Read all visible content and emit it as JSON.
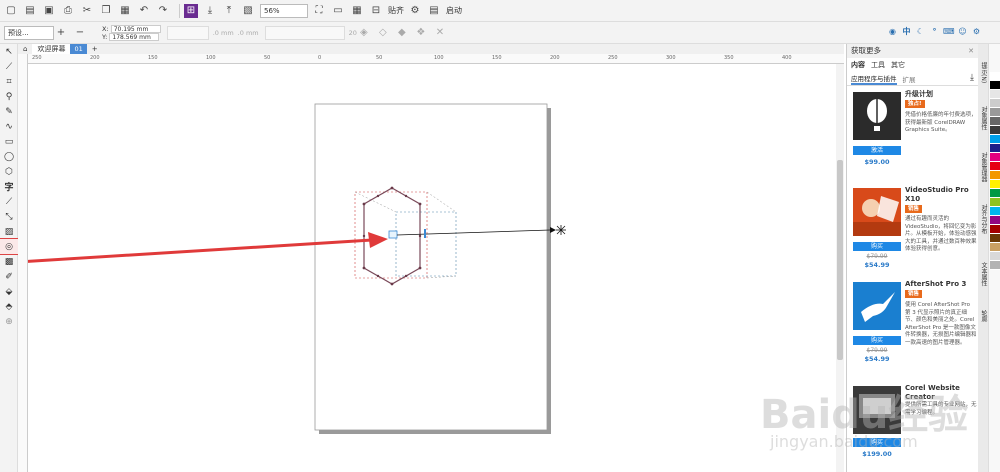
{
  "toolbar": {
    "zoom": "56%",
    "snap_label": "贴齐",
    "launch_label": "启动"
  },
  "propbar": {
    "preset": "预设...",
    "x": "70.195 mm",
    "y": "178.569 mm",
    "x_label": "X:",
    "y_label": "Y:",
    "mm1": ".0 mm",
    "mm2": ".0 mm",
    "steps": "20",
    "lang": "中"
  },
  "tabs": {
    "welcome": "欢迎屏幕",
    "doc": "01"
  },
  "ruler": {
    "h_ticks": [
      "250",
      "200",
      "150",
      "100",
      "50",
      "0",
      "50",
      "100",
      "150",
      "200",
      "250",
      "300",
      "350",
      "400"
    ]
  },
  "docker": {
    "title": "获取更多",
    "tabs": [
      "内容",
      "工具",
      "其它"
    ],
    "subtabs": [
      "应用程序与插件",
      "扩展"
    ],
    "products": [
      {
        "name": "升级计划",
        "badge": "独占!",
        "desc": "凭借价格低廉的年付费选项，获得最新版 CorelDRAW Graphics Suite。",
        "button": "激活",
        "old_price": "",
        "price": "$99.00"
      },
      {
        "name": "VideoStudio Pro X10",
        "badge": "销售",
        "desc": "通过有趣而灵活的 VideoStudio，将回忆变为影片。从模板开始，体验动感强大的工具，并通过数百种效果体验获得创意。",
        "button": "购买",
        "old_price": "$79.99",
        "price": "$54.99"
      },
      {
        "name": "AfterShot Pro 3",
        "badge": "销售",
        "desc": "使用 Corel AfterShot Pro 第 3 代显示照片的真正细节、颜色和美丽之处。Corel AfterShot Pro 是一款图像文件转换器，无损图片编辑器和一款高速的图片管理器。",
        "button": "购买",
        "old_price": "$79.99",
        "price": "$54.99"
      },
      {
        "name": "Corel Website Creator",
        "badge": "",
        "desc": "提供所需工具的专业网站，无需学习编程。",
        "button": "购买",
        "old_price": "",
        "price": "$199.00"
      }
    ]
  },
  "sidetabs": [
    "提示(N)",
    "对象属性",
    "对象管理器",
    "对齐与分布",
    "文本属性",
    "轮廓"
  ],
  "palette": [
    "#ffffff",
    "#000000",
    "#e6e6e6",
    "#cccccc",
    "#999999",
    "#666666",
    "#3a3a3a",
    "#00a0e9",
    "#1d2088",
    "#e4007f",
    "#e60012",
    "#f39800",
    "#fff100",
    "#009944",
    "#8fc31f",
    "#00b7ee",
    "#920783",
    "#a40000",
    "#6a3906",
    "#c9a063",
    "#d9d9d9",
    "#b3b3b3"
  ],
  "watermark": {
    "main": "Baidu经验",
    "sub": "jingyan.baidu.com"
  }
}
